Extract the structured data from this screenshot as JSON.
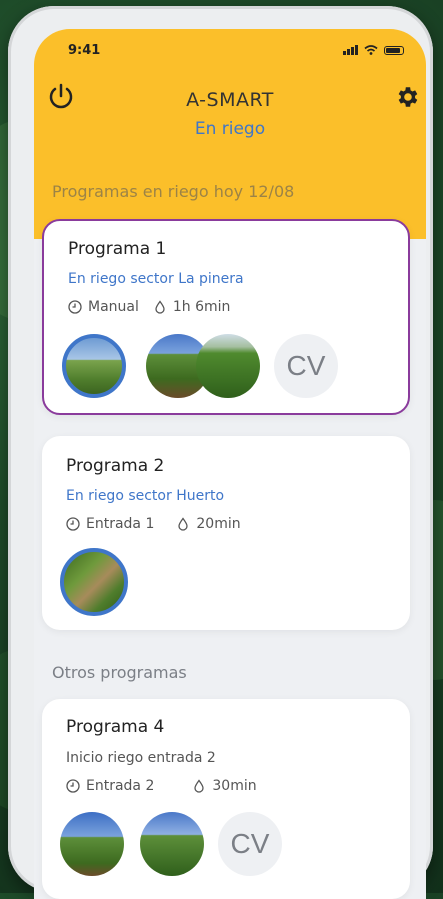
{
  "status_bar": {
    "time": "9:41"
  },
  "header": {
    "app_title": "A-SMART",
    "status": "En riego",
    "power_icon": "power-icon",
    "settings_icon": "gear-icon"
  },
  "sections": {
    "active_title": "Programas en riego hoy 12/08",
    "other_title": "Otros programas"
  },
  "programs": [
    {
      "title": "Programa 1",
      "subtitle": "En riego sector La pinera",
      "start": "Manual",
      "duration": "1h 6min",
      "avatar_initials": "CV"
    },
    {
      "title": "Programa 2",
      "subtitle": "En riego sector Huerto",
      "start": "Entrada 1",
      "duration": "20min"
    },
    {
      "title": "Programa 4",
      "subtitle": "Inicio riego entrada 2",
      "start": "Entrada 2",
      "duration": "30min",
      "avatar_initials": "CV"
    }
  ],
  "colors": {
    "header_bg": "#fbbf2a",
    "accent_blue": "#3f76c9",
    "selected_border": "#8a3b9c"
  }
}
